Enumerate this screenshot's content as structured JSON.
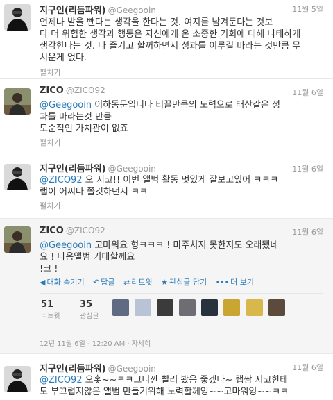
{
  "tweets": [
    {
      "name": "지구인(리듬파워)",
      "handle": "@Geegooin",
      "date": "11월 5일",
      "lines": [
        "언제나 발을 뺀다는 생각을 한다는 것. 여지를 남겨둔다는 것보",
        "다 더 위험한 생각과 행동은 자신에게 온 소중한 기회에 대해 나태하게",
        "생각한다는 것. 다 즐기고 할꺼하면서 성과를 이루길 바라는 것만큼 무",
        "서운게 없다."
      ],
      "expand_label": "펼치기"
    },
    {
      "name": "ZICO",
      "handle": "@ZICO92",
      "date": "11월 6일",
      "mention": "@Geegooin",
      "lines": [
        " 이하동문입니다 티끌만큼의 노력으로 태산같은 성",
        "과를 바라는것 만큼",
        "모순적인 가치관이 없죠"
      ],
      "expand_label": "펼치기"
    },
    {
      "name": "지구인(리듬파워)",
      "handle": "@Geegooin",
      "date": "11월 6일",
      "mention": "@ZICO92",
      "lines": [
        " 오 지코!! 이번 앨범 활동 멋있게 잘보고있어 ㅋㅋㅋ",
        "랩이 어찌나 쫄깃하던지 ㅋㅋ"
      ],
      "expand_label": "펼치기"
    },
    {
      "name": "ZICO",
      "handle": "@ZICO92",
      "date": "11월 6일",
      "mention": "@Geegooin",
      "lines": [
        " 고마워요 형ㅋㅋㅋ ! 마주치지 못한지도 오래됐네",
        "요 ! 다음앨범 기대할께요",
        "!크 !"
      ],
      "actions": [
        {
          "icon": "reply-icon",
          "glyph": "◀",
          "label": "대화 숨기기"
        },
        {
          "icon": "reply-arrow-icon",
          "glyph": "↶",
          "label": "답글"
        },
        {
          "icon": "retweet-icon",
          "glyph": "⇄",
          "label": "리트윗"
        },
        {
          "icon": "star-icon",
          "glyph": "★",
          "label": "관심글 담기"
        },
        {
          "icon": "more-icon",
          "glyph": "•••",
          "label": "더 보기"
        }
      ],
      "retweets": "51",
      "retweets_label": "리트윗",
      "favorites": "35",
      "favorites_label": "관심글",
      "timestamp": "12년 11월 6일 - 12:20 AM",
      "details_label": "자세히"
    },
    {
      "name": "지구인(리듬파워)",
      "handle": "@Geegooin",
      "date": "11월 6일",
      "mention": "@ZICO92",
      "lines": [
        " 오홋~~ㅋㅋ그니깐 빨리 봤음 좋겠다~ 랩짱 지코한테",
        "도 부끄럽지않은 앨범 만들기위해 노력할께잉~~고마워잉~~ㅋㅋ"
      ]
    }
  ],
  "colors": {
    "link": "#2b7bb9",
    "muted": "#999999",
    "expanded_bg": "#f5f5f5"
  }
}
